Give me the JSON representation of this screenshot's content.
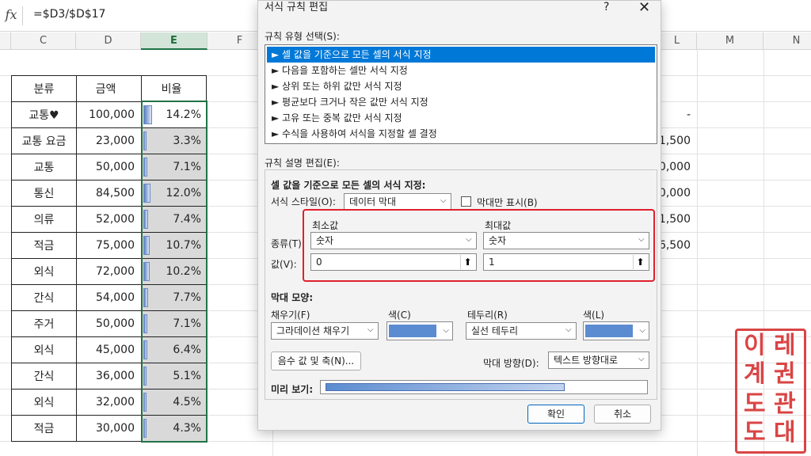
{
  "formula_bar": {
    "fx": "fx",
    "formula": "=$D3/$D$17"
  },
  "columns": [
    "C",
    "D",
    "E",
    "F",
    "L",
    "M",
    "N"
  ],
  "table": {
    "headers": [
      "분류",
      "금액",
      "비율"
    ],
    "rows": [
      {
        "category": "교통♥",
        "amount": "100,000",
        "ratio": "14.2%",
        "bar_fraction": 0.142
      },
      {
        "category": "교통 요금",
        "amount": "23,000",
        "ratio": "3.3%",
        "bar_fraction": 0.033
      },
      {
        "category": "교통",
        "amount": "50,000",
        "ratio": "7.1%",
        "bar_fraction": 0.071
      },
      {
        "category": "통신",
        "amount": "84,500",
        "ratio": "12.0%",
        "bar_fraction": 0.12
      },
      {
        "category": "의류",
        "amount": "52,000",
        "ratio": "7.4%",
        "bar_fraction": 0.074
      },
      {
        "category": "적금",
        "amount": "75,000",
        "ratio": "10.7%",
        "bar_fraction": 0.107
      },
      {
        "category": "외식",
        "amount": "72,000",
        "ratio": "10.2%",
        "bar_fraction": 0.102
      },
      {
        "category": "간식",
        "amount": "54,000",
        "ratio": "7.7%",
        "bar_fraction": 0.077
      },
      {
        "category": "주거",
        "amount": "50,000",
        "ratio": "7.1%",
        "bar_fraction": 0.071
      },
      {
        "category": "외식",
        "amount": "45,000",
        "ratio": "6.4%",
        "bar_fraction": 0.064
      },
      {
        "category": "간식",
        "amount": "36,000",
        "ratio": "5.1%",
        "bar_fraction": 0.051
      },
      {
        "category": "외식",
        "amount": "32,000",
        "ratio": "4.5%",
        "bar_fraction": 0.045
      },
      {
        "category": "적금",
        "amount": "30,000",
        "ratio": "4.3%",
        "bar_fraction": 0.043
      }
    ]
  },
  "right_column_values": [
    "-",
    "1,500",
    "0,000",
    "0,000",
    "1,500",
    "6,500"
  ],
  "dialog": {
    "title": "서식 규칙 편집",
    "help": "?",
    "close": "✕",
    "rule_type_label": "규칙 유형 선택(S):",
    "rule_types": [
      "► 셀 값을 기준으로 모든 셀의 서식 지정",
      "► 다음을 포함하는 셀만 서식 지정",
      "► 상위 또는 하위 값만 서식 지정",
      "► 평균보다 크거나 작은 값만 서식 지정",
      "► 고유 또는 중복 값만 서식 지정",
      "► 수식을 사용하여 서식을 지정할 셀 결정"
    ],
    "desc_label": "규칙 설명 편집(E):",
    "desc_heading": "셀 값을 기준으로 모든 셀의 서식 지정:",
    "format_style_label": "서식 스타일(O):",
    "format_style_value": "데이터 막대",
    "show_bar_only_label": "막대만 표시(B)",
    "min_label": "최소값",
    "max_label": "최대값",
    "type_label": "종류(T):",
    "value_label": "값(V):",
    "min_type": "숫자",
    "max_type": "숫자",
    "min_value": "0",
    "max_value": "1",
    "bar_appearance_label": "막대 모양:",
    "fill_label": "채우기(F)",
    "fill_value": "그라데이션 채우기",
    "fill_color_label": "색(C)",
    "border_label": "테두리(R)",
    "border_value": "실선 테두리",
    "border_color_label": "색(L)",
    "bar_color": "#5b8bd0",
    "negative_button": "음수 값 및 축(N)...",
    "bar_direction_label": "막대 방향(D):",
    "bar_direction_value": "텍스트 방향대로",
    "preview_label": "미리 보기:",
    "ok": "확인",
    "cancel": "취소",
    "highlight_color": "#e0202c"
  },
  "stamp": {
    "chars": [
      "이",
      "레",
      "계",
      "권",
      "도",
      "관",
      "도",
      "대"
    ]
  }
}
